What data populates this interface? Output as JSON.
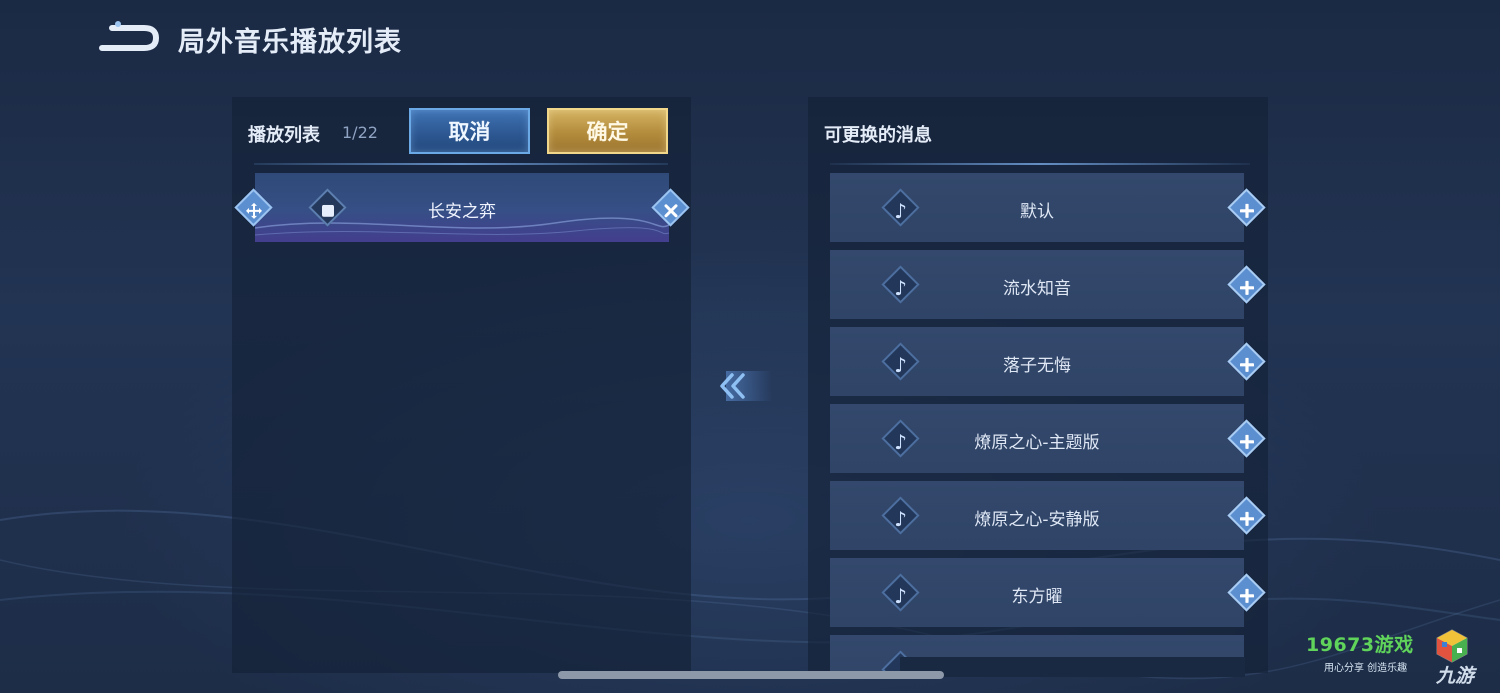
{
  "header": {
    "title": "局外音乐播放列表"
  },
  "playlist": {
    "label": "播放列表",
    "count": "1/22",
    "cancel_label": "取消",
    "confirm_label": "确定",
    "tracks": [
      {
        "title": "长安之弈"
      }
    ]
  },
  "available": {
    "header": "可更换的消息",
    "songs": [
      {
        "title": "默认"
      },
      {
        "title": "流水知音"
      },
      {
        "title": "落子无悔"
      },
      {
        "title": "燎原之心-主题版"
      },
      {
        "title": "燎原之心-安静版"
      },
      {
        "title": "东方曜"
      }
    ]
  },
  "watermark": {
    "brand": "19673游戏",
    "slogan": "用心分享 创造乐趣",
    "sub": "九游"
  },
  "colors": {
    "background": "#1f2f4b",
    "accent_blue": "#5c8fd0",
    "confirm_gold": "#b38c3c",
    "cancel_blue": "#2c5690"
  },
  "icons": {
    "back": "back-arrow-icon",
    "move": "move-icon",
    "stop": "stop-icon",
    "remove": "close-icon",
    "note": "music-note-icon",
    "add": "plus-icon",
    "transfer": "double-chevron-left-icon"
  }
}
